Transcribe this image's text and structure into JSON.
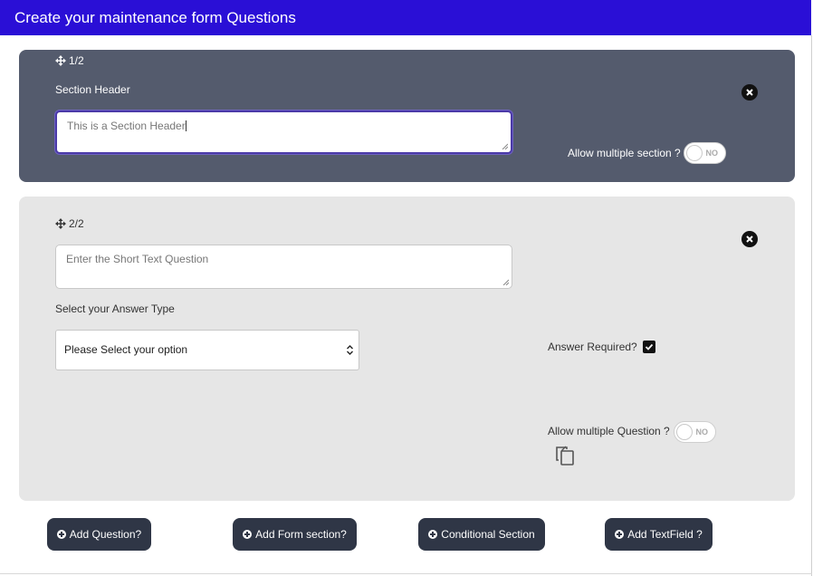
{
  "header": {
    "title": "Create your maintenance form Questions"
  },
  "section1": {
    "index": "1/2",
    "label": "Section Header",
    "input_value": "This is a Section Header",
    "allow_multiple_label": "Allow multiple section ?",
    "toggle_text": "NO"
  },
  "section2": {
    "index": "2/2",
    "question_placeholder": "Enter the Short Text Question",
    "answer_type_label": "Select your Answer Type",
    "select_value": "Please Select your option",
    "answer_required_label": "Answer Required?",
    "answer_required_checked": true,
    "allow_multiple_label": "Allow multiple Question ?",
    "toggle_text": "NO"
  },
  "actions": [
    {
      "label": "Add Question?"
    },
    {
      "label": "Add Form section?"
    },
    {
      "label": "Conditional Section"
    },
    {
      "label": "Add TextField ?"
    }
  ],
  "icons": {
    "drag": "move-arrows-icon",
    "close": "close-circle-icon",
    "copy": "copy-icon",
    "add": "plus-circle-icon"
  },
  "colors": {
    "header_bg": "#2a0fd6",
    "section_header_bg": "#545b6d",
    "question_bg": "#e6e6e6",
    "button_bg": "#2f3646"
  }
}
